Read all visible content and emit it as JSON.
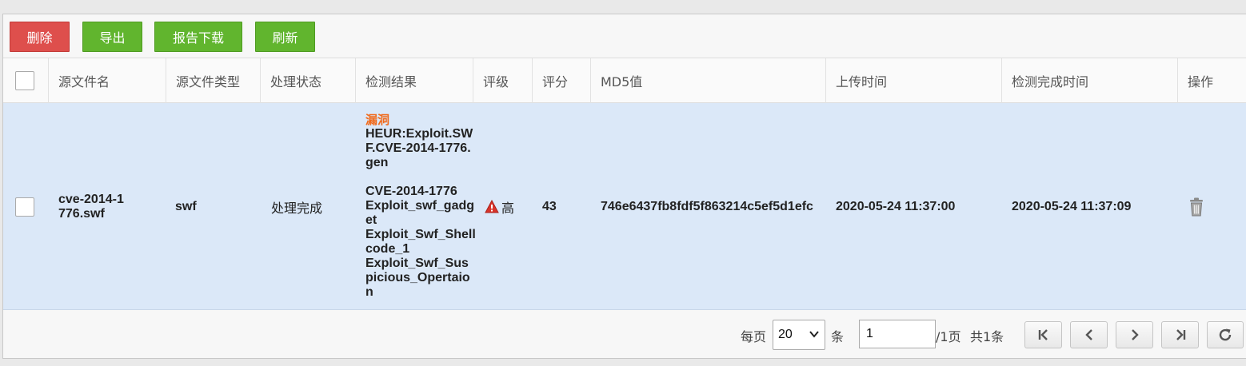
{
  "toolbar": {
    "delete_label": "删除",
    "export_label": "导出",
    "report_download_label": "报告下载",
    "refresh_label": "刷新"
  },
  "table": {
    "columns": [
      "源文件名",
      "源文件类型",
      "处理状态",
      "检测结果",
      "评级",
      "评分",
      "MD5值",
      "上传时间",
      "检测完成时间",
      "操作"
    ],
    "rows": [
      {
        "file_name": "cve-2014-1776.swf",
        "file_type": "swf",
        "status": "处理完成",
        "result_tag": "漏洞",
        "result_name": "HEUR:Exploit.SWF.CVE-2014-1776.gen",
        "result_details": [
          "CVE-2014-1776",
          "Exploit_swf_gadget",
          "Exploit_Swf_Shellcode_1",
          "Exploit_Swf_Suspicious_Opertaion"
        ],
        "rating": "高",
        "rating_icon": "warning-icon",
        "score": "43",
        "md5": "746e6437fb8fdf5f863214c5ef5d1efc",
        "upload_time": "2020-05-24 11:37:00",
        "finish_time": "2020-05-24 11:37:09",
        "action_icon": "trash-icon"
      }
    ]
  },
  "pagination": {
    "per_page_prefix": "每页",
    "per_page_value": "20",
    "per_page_suffix": "条",
    "current_page": "1",
    "total_pages_text": "/1页",
    "total_count_text": "共1条",
    "icons": [
      "first-page-icon",
      "prev-page-icon",
      "next-page-icon",
      "last-page-icon",
      "reload-icon"
    ]
  },
  "colors": {
    "delete_button": "#de4f4c",
    "action_buttons": "#61b52e",
    "row_highlight": "#dbe8f8",
    "vuln_tag": "#f06a1c",
    "warning": "#d9342b"
  }
}
